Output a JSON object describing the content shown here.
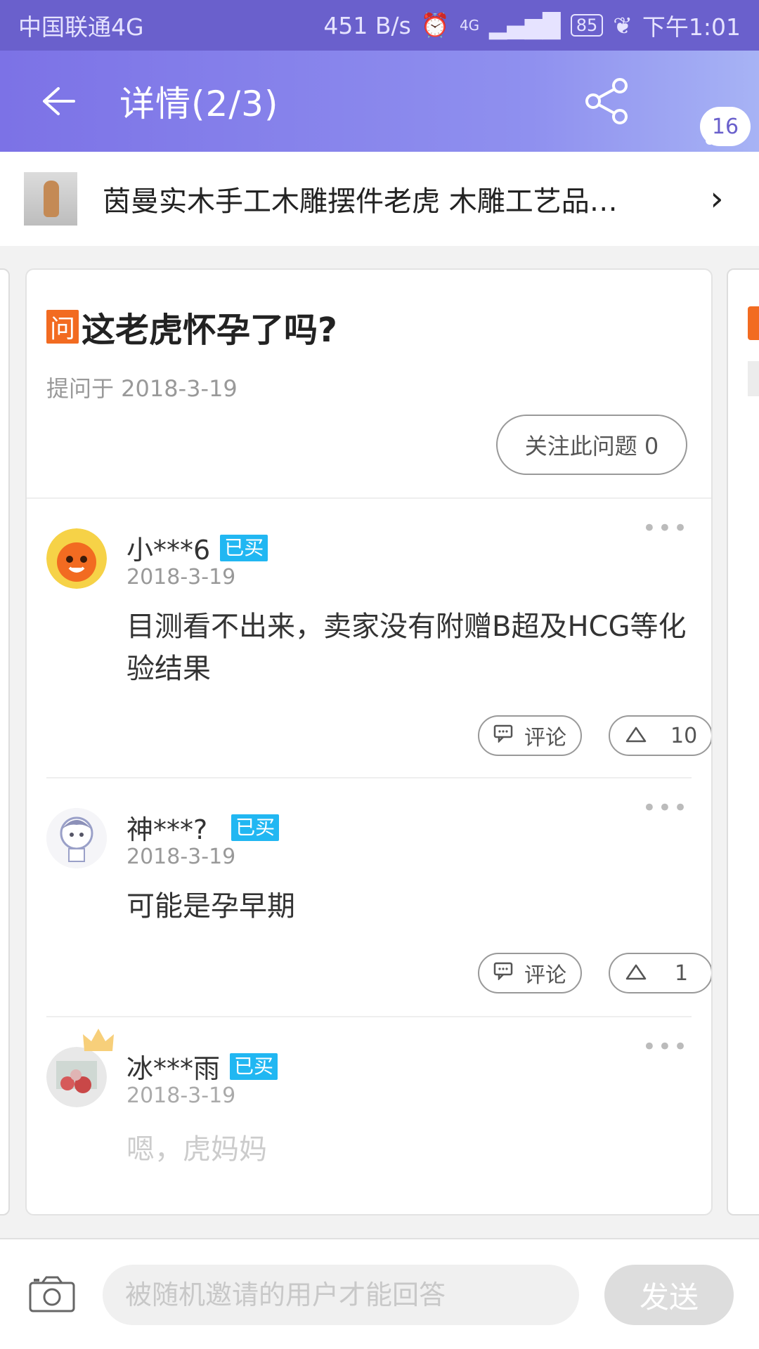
{
  "status_bar": {
    "carrier": "中国联通4G",
    "net_speed": "451 B/s",
    "network": "4G",
    "battery": "85",
    "time": "下午1:01"
  },
  "app_bar": {
    "title": "详情(2/3)",
    "badge_count": "16",
    "icons": [
      "back-arrow-icon",
      "share-icon",
      "more-vertical-icon"
    ]
  },
  "product": {
    "title": "茵曼实木手工木雕摆件老虎 木雕工艺品…"
  },
  "question": {
    "tag": "问",
    "title": "这老虎怀孕了吗?",
    "date": "提问于 2018-3-19",
    "follow_label": "关注此问题 0"
  },
  "answers": [
    {
      "user": "小***6",
      "tag": "已买",
      "date": "2018-3-19",
      "text": "目测看不出来，卖家没有附赠B超及HCG等化验结果",
      "comment_label": "评论",
      "likes": "10",
      "more": "•••"
    },
    {
      "user": "神***?",
      "tag": "已买",
      "date": "2018-3-19",
      "text": "可能是孕早期",
      "comment_label": "评论",
      "likes": "1",
      "more": "•••"
    },
    {
      "user": "冰***雨",
      "tag": "已买",
      "date": "2018-3-19",
      "text": "嗯，虎妈妈",
      "more": "•••"
    }
  ],
  "bottom_bar": {
    "placeholder": "被随机邀请的用户才能回答",
    "send_label": "发送"
  },
  "colors": {
    "status_bar": "#6a60cc",
    "app_bar_start": "#7c72e6",
    "question_tag": "#f26b21",
    "bought_tag": "#21b7f2"
  }
}
